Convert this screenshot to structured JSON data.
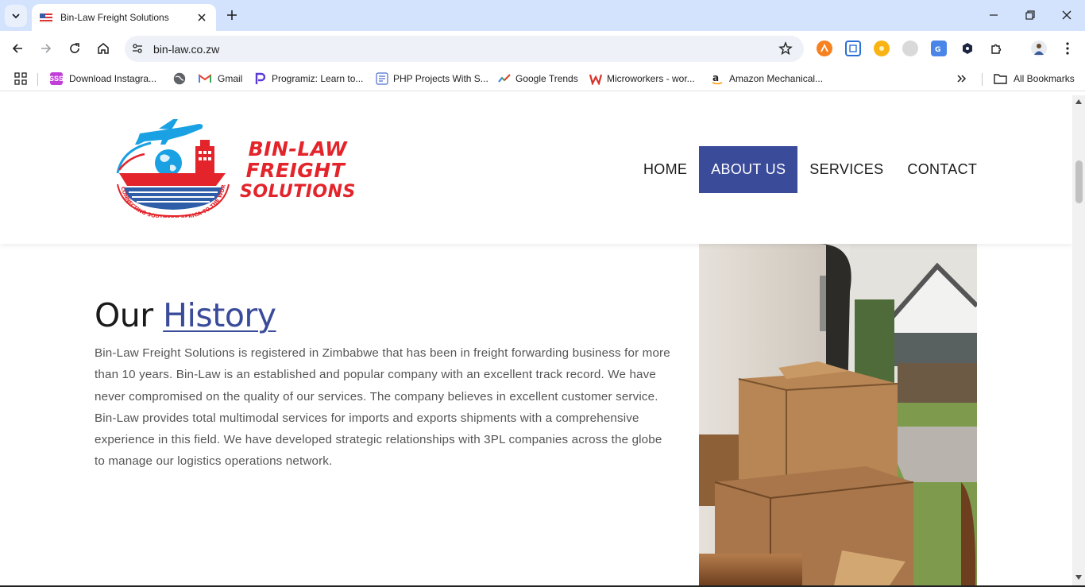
{
  "browser": {
    "tab_title": "Bin-Law Freight Solutions",
    "url": "bin-law.co.zw",
    "bookmarks": [
      {
        "label": "Download Instagra...",
        "icon": "sss-icon",
        "badge": "SSS",
        "color": "#c13fd8"
      },
      {
        "label": "",
        "icon": "globe-icon",
        "color": "#5f6368"
      },
      {
        "label": "Gmail",
        "icon": "gmail-icon",
        "color": "#ea4335"
      },
      {
        "label": "Programiz: Learn to...",
        "icon": "programiz-icon",
        "color": "#5b3bd6"
      },
      {
        "label": "PHP Projects With S...",
        "icon": "php-icon",
        "color": "#4a6fd1"
      },
      {
        "label": "Google Trends",
        "icon": "trends-icon",
        "color": "#34a853"
      },
      {
        "label": "Microworkers - wor...",
        "icon": "microworkers-icon",
        "color": "#d6322b"
      },
      {
        "label": "Amazon Mechanical...",
        "icon": "amazon-icon",
        "color": "#222222"
      }
    ],
    "all_bookmarks": "All Bookmarks"
  },
  "site": {
    "logo": {
      "line1": "BIN-LAW",
      "line2": "FREIGHT",
      "line3": "SOLUTIONS",
      "tagline": "CONNECTING SOUTHERN AFRICA TO THE WORLD"
    },
    "nav": [
      {
        "label": "HOME",
        "active": false
      },
      {
        "label": "ABOUT US",
        "active": true
      },
      {
        "label": "SERVICES",
        "active": false
      },
      {
        "label": "CONTACT",
        "active": false
      }
    ],
    "colors": {
      "accent": "#3a4b9a",
      "brand_red": "#e3242b",
      "brand_blue": "#1aa1e3"
    }
  },
  "history": {
    "title_plain": "Our",
    "title_accent": "History",
    "text": "Bin-Law Freight Solutions is registered in Zimbabwe that has been in freight forwarding business for more than 10 years. Bin-Law is an established and popular company with an excellent track record. We have never compromised on the quality of our services. The company believes in excellent customer service. Bin-Law provides total multimodal services for imports and exports shipments with a comprehensive experience in this field. We have developed strategic relationships with 3PL companies across the globe to manage our logistics operations network."
  }
}
